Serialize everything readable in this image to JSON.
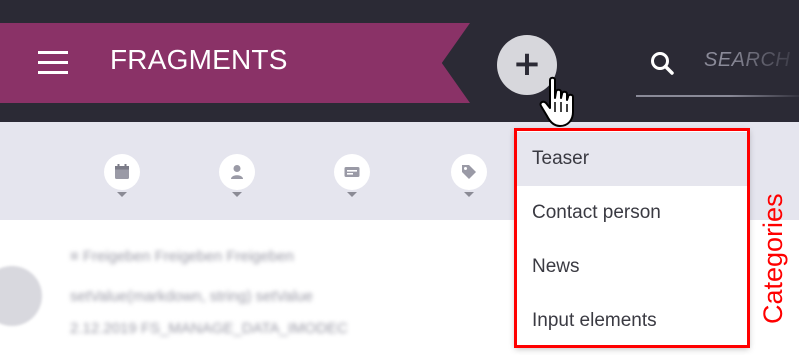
{
  "header": {
    "title": "FRAGMENTS",
    "search_placeholder": "SEARCH",
    "add_label": "+"
  },
  "filters": [
    {
      "icon": "calendar-icon"
    },
    {
      "icon": "person-icon"
    },
    {
      "icon": "card-icon"
    },
    {
      "icon": "tag-icon"
    }
  ],
  "list": {
    "lines": [
      "≡ Freigeben Freigeben Freigeben",
      "setValue(markdown, string) setValue",
      "2.12.2019 FS_MANAGE_DATA_IMODEC"
    ]
  },
  "dropdown": {
    "items": [
      {
        "label": "Teaser",
        "active": true
      },
      {
        "label": "Contact person",
        "active": false
      },
      {
        "label": "News",
        "active": false
      },
      {
        "label": "Input elements",
        "active": false
      }
    ]
  },
  "annotation": {
    "label": "Categories",
    "color": "#ff0000"
  },
  "colors": {
    "brand": "#8a3267",
    "header_bg": "#2b2a35",
    "filter_bg": "#e5e5ee"
  }
}
